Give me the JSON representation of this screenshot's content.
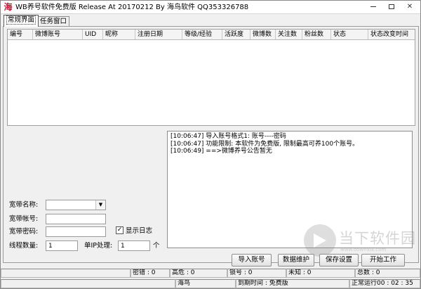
{
  "window": {
    "logo": "海",
    "title": "WB养号软件免费版 Release At 20170212 By 海鸟软件 QQ353326788"
  },
  "tabs": [
    {
      "label": "常规界面",
      "active": true
    },
    {
      "label": "任务窗口",
      "active": false
    }
  ],
  "grid": {
    "columns": [
      "编号",
      "微博账号",
      "UID",
      "昵称",
      "注册日期",
      "等级/经验",
      "活跃度",
      "微博数",
      "关注数",
      "粉丝数",
      "状态",
      "状态改变时间"
    ],
    "rows": []
  },
  "form": {
    "broadband_name_label": "宽带名称:",
    "broadband_name_value": "",
    "broadband_account_label": "宽带帐号:",
    "broadband_account_value": "",
    "broadband_password_label": "宽带密码:",
    "broadband_password_value": "",
    "show_log_label": "显示日志",
    "show_log_checked": true,
    "check_mark": "✓",
    "thread_count_label": "线程数量:",
    "thread_count_value": "1",
    "per_ip_label": "单IP处理:",
    "per_ip_value": "1",
    "per_ip_unit": "个"
  },
  "log": [
    "[10:06:47] 导入账号格式1: 账号----密码",
    "[10:06:47] 功能限制: 本软件为免费版, 限制最高可养100个账号。",
    "[10:06:49] ==>微博养号公告暂无"
  ],
  "buttons": {
    "import": "导入账号",
    "maintain": "数据维护",
    "save": "保存设置",
    "start": "开始工作"
  },
  "status_bar": {
    "error": "密错 : 0",
    "danger": "高危 : 0",
    "locked": "锁号 : 0",
    "unknown": "未知 : 0",
    "total": "总数 : 0",
    "brand": "海鸟",
    "expire": "到期时间 : 免费版",
    "running": "正常运行00 : 02 : 35"
  },
  "watermark": {
    "text": "当下软件园",
    "sub": "www.downxia.com"
  }
}
